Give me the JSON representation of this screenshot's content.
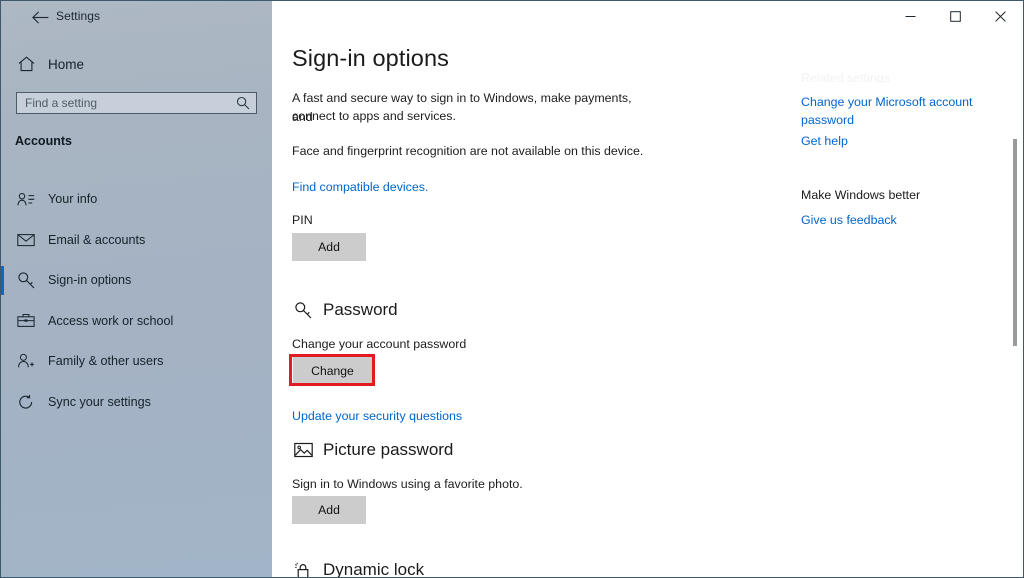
{
  "window": {
    "title": "Settings",
    "back_icon": "back-arrow-icon",
    "controls": {
      "minimize": "minimize-icon",
      "maximize": "maximize-icon",
      "close": "close-icon"
    }
  },
  "sidebar": {
    "home_label": "Home",
    "home_icon": "home-icon",
    "search": {
      "placeholder": "Find a setting",
      "value": "",
      "icon": "search-icon"
    },
    "section_label": "Accounts",
    "items": [
      {
        "label": "Your info",
        "icon": "user-info-icon",
        "selected": false
      },
      {
        "label": "Email & accounts",
        "icon": "envelope-icon",
        "selected": false
      },
      {
        "label": "Sign-in options",
        "icon": "key-icon",
        "selected": true
      },
      {
        "label": "Access work or school",
        "icon": "briefcase-icon",
        "selected": false
      },
      {
        "label": "Family & other users",
        "icon": "user-add-icon",
        "selected": false
      },
      {
        "label": "Sync your settings",
        "icon": "sync-icon",
        "selected": false
      }
    ]
  },
  "main": {
    "page_title": "Sign-in options",
    "intro_line1": "A fast and secure way to sign in to Windows, make payments, and",
    "intro_line2": "connect to apps and services.",
    "availability_note": "Face and fingerprint recognition are not available on this device.",
    "find_devices_link": "Find compatible devices.",
    "pin": {
      "label": "PIN",
      "button": "Add"
    },
    "password": {
      "heading": "Password",
      "icon": "key-icon",
      "description": "Change your account password",
      "button": "Change",
      "security_questions_link": "Update your security questions"
    },
    "picture_password": {
      "heading": "Picture password",
      "icon": "picture-icon",
      "description": "Sign in to Windows using a favorite photo.",
      "button": "Add"
    },
    "dynamic_lock": {
      "heading": "Dynamic lock",
      "icon": "dynamic-lock-icon"
    }
  },
  "right_panel": {
    "ghost_heading": "Related settings",
    "change_ms_password_line1": "Change your Microsoft account",
    "change_ms_password_line2": "password",
    "get_help_link": "Get help",
    "make_windows_better_heading": "Make Windows better",
    "feedback_link": "Give us feedback"
  },
  "colors": {
    "accent": "#0a69c7",
    "link": "#0066cc",
    "highlight": "#e01b22",
    "sidebar_top": "#adb8c3",
    "sidebar_bottom": "#a2b4c7",
    "button_face": "#cccccc"
  }
}
